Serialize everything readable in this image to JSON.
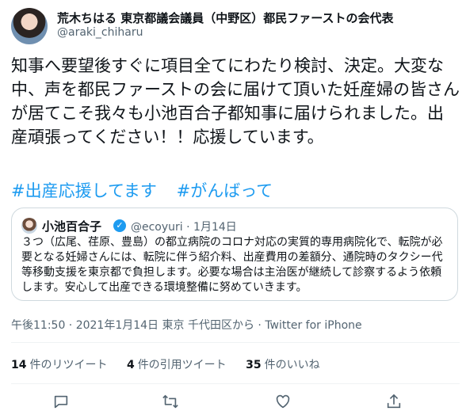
{
  "author": {
    "name": "荒木ちはる 東京都議会議員（中野区）都民ファーストの会代表",
    "handle": "@araki_chiharu"
  },
  "tweet": {
    "text": "知事へ要望後すぐに項目全てにわたり検討、決定。大変な中、声を都民ファーストの会に届けて頂いた妊産婦の皆さんが居てこそ我々も小池百合子都知事に届けられました。出産頑張ってください！！応援しています。",
    "hashtags": [
      "#出産応援してます",
      "#がんばって"
    ]
  },
  "quote": {
    "name": "小池百合子",
    "handle": "@ecoyuri",
    "date": "· 1月14日",
    "text": "３つ（広尾、荏原、豊島）の都立病院のコロナ対応の実質的専用病院化で、転院が必要となる妊婦さんには、転院に伴う紹介料、出産費用の差額分、通院時のタクシー代等移動支援を東京都で負担します。必要な場合は主治医が継続して診察するよう依頼します。安心して出産できる環境整備に努めていきます。"
  },
  "meta": {
    "time": "午後11:50 · 2021年1月14日",
    "location": "東京 千代田区から",
    "sep": " · ",
    "source": "Twitter for iPhone"
  },
  "stats": {
    "retweets_count": "14",
    "retweets_label": "件のリツイート",
    "quotes_count": "4",
    "quotes_label": "件の引用ツイート",
    "likes_count": "35",
    "likes_label": "件のいいね"
  },
  "colors": {
    "accent": "#1d9bf0",
    "secondary_text": "#536471",
    "border": "#cfd9de"
  },
  "icons": [
    "reply-icon",
    "retweet-icon",
    "like-icon",
    "share-icon"
  ]
}
